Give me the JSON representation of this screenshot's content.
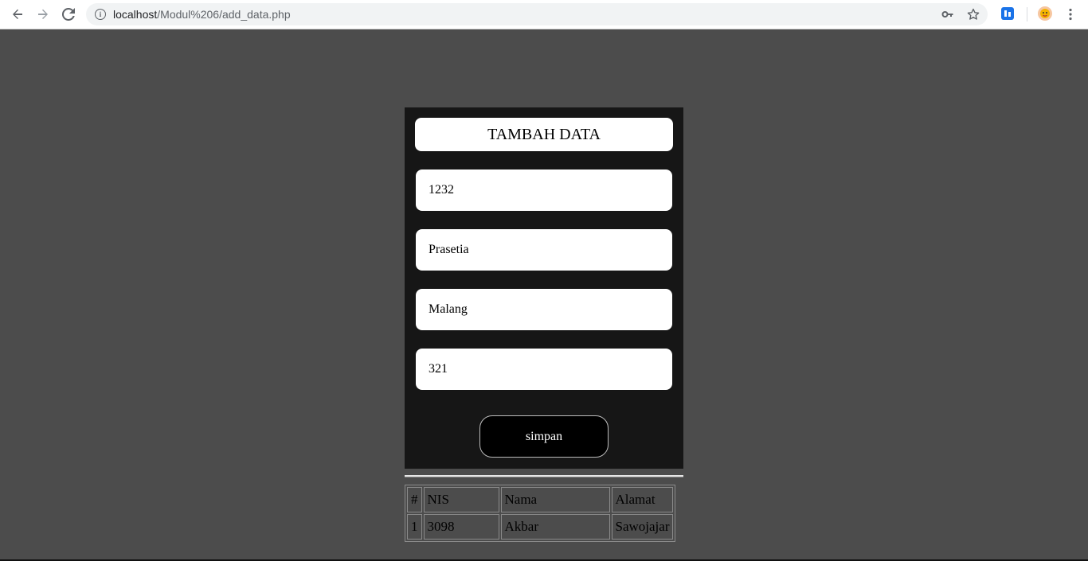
{
  "browser": {
    "url_host": "localhost",
    "url_path": "/Modul%206/add_data.php",
    "icons": [
      "back-icon",
      "forward-icon",
      "reload-icon",
      "info-icon",
      "key-icon",
      "star-icon",
      "extension-icon",
      "profile-avatar-icon",
      "menu-icon"
    ],
    "extension_color": "#1a73e8",
    "avatar_color": "#f4b400"
  },
  "form": {
    "title": "TAMBAH DATA",
    "fields": [
      {
        "value": "1232"
      },
      {
        "value": "Prasetia"
      },
      {
        "value": "Malang"
      },
      {
        "value": "321"
      }
    ],
    "submit_label": "simpan"
  },
  "table": {
    "headers": [
      "#",
      "NIS",
      "Nama",
      "Alamat"
    ],
    "rows": [
      [
        "1",
        "3098",
        "Akbar",
        "Sawojajar"
      ]
    ]
  },
  "colors": {
    "page_bg": "#4c4c4c",
    "panel_bg": "#161616",
    "button_bg": "#000000"
  }
}
